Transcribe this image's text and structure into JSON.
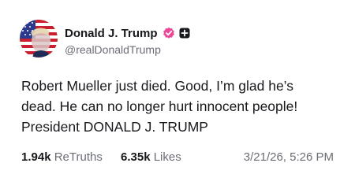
{
  "author": {
    "display_name": "Donald J. Trump",
    "handle": "@realDonaldTrump",
    "verified_icon": "verified-badge-icon",
    "extra_icon": "plus-square-icon",
    "accent_color": "#ec4899"
  },
  "post": {
    "lines": [
      "Robert Mueller just died. Good, I’m glad he’s",
      "dead. He can no longer hurt innocent people!",
      "President DONALD J. TRUMP"
    ]
  },
  "stats": {
    "retruths_count": "1.94k",
    "retruths_label": "ReTruths",
    "likes_count": "6.35k",
    "likes_label": "Likes",
    "timestamp": "3/21/26, 5:26 PM"
  }
}
